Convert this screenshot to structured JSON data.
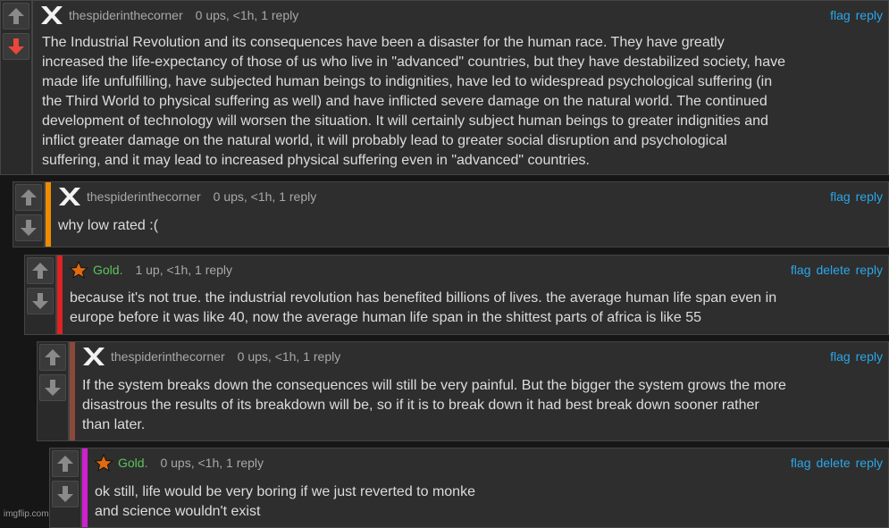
{
  "comments": [
    {
      "username": "thespiderinthecorner",
      "meta": "0 ups, <1h, 1 reply",
      "actions": [
        "flag",
        "reply"
      ],
      "text": "The Industrial Revolution and its consequences have been a disaster for the human race. They have greatly\nincreased the life-expectancy of those of us who live in \"advanced\" countries, but they have destabilized society, have\nmade life unfulfilling, have subjected human beings to indignities, have led to widespread psychological suffering (in\nthe Third World to physical suffering as well) and have inflicted severe damage on the natural world. The continued\ndevelopment of technology will worsen the situation. It will certainly subject human beings to greater indignities and\ninflict greater damage on the natural world, it will probably lead to greater social disruption and psychological\nsuffering, and it may lead to increased physical suffering even in \"advanced\" countries.",
      "vote_state": "downvoted",
      "bar_color": ""
    },
    {
      "username": "thespiderinthecorner",
      "meta": "0 ups, <1h, 1 reply",
      "actions": [
        "flag",
        "reply"
      ],
      "text": "why low rated :(",
      "vote_state": "none",
      "bar_color": "#f08c00"
    },
    {
      "username": "Gold.",
      "meta": "1 up, <1h, 1 reply",
      "actions": [
        "flag",
        "delete",
        "reply"
      ],
      "text": "because it's not true. the industrial revolution has benefited billions of lives. the average human life span even in\neurope before it was like 40, now the average human life span in the shittest parts of africa is like 55",
      "vote_state": "none",
      "bar_color": "#e02222"
    },
    {
      "username": "thespiderinthecorner",
      "meta": "0 ups, <1h, 1 reply",
      "actions": [
        "flag",
        "reply"
      ],
      "text": "If the system breaks down the consequences will still be very painful. But the bigger the system grows the more\ndisastrous the results of its breakdown will be, so if it is to break down it had best break down sooner rather\nthan later.",
      "vote_state": "none",
      "bar_color": "#8a4a3a"
    },
    {
      "username": "Gold.",
      "meta": "0 ups, <1h, 1 reply",
      "actions": [
        "flag",
        "delete",
        "reply"
      ],
      "text": "ok still, life would be very boring if we just reverted to monke\nand science wouldn't exist",
      "vote_state": "none",
      "bar_color": "#d020d0"
    }
  ],
  "watermark": "imgflip.com"
}
